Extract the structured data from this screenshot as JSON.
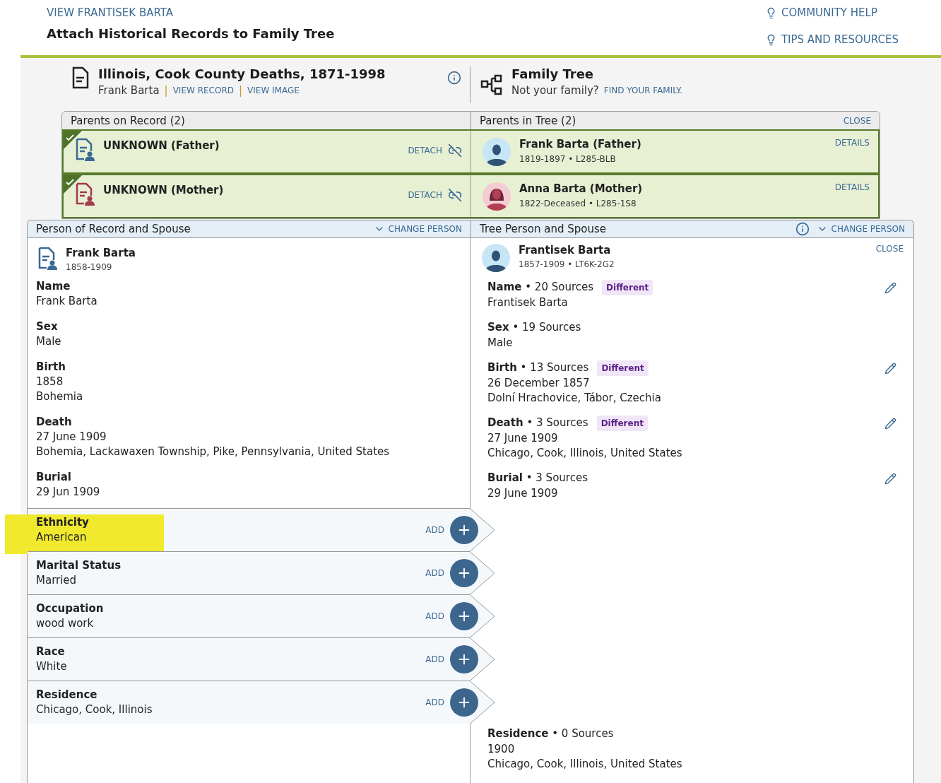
{
  "header": {
    "breadcrumb": "VIEW FRANTISEK BARTA",
    "title": "Attach Historical Records to Family Tree",
    "links": [
      "COMMUNITY HELP",
      "TIPS AND RESOURCES"
    ]
  },
  "record": {
    "title": "Illinois, Cook County Deaths, 1871-1998",
    "person": "Frank Barta",
    "links": [
      {
        "separator": "|",
        "label": "VIEW RECORD"
      },
      {
        "separator": "|",
        "label": "VIEW IMAGE"
      }
    ]
  },
  "tree": {
    "title": "Family Tree",
    "prompt": "Not your family?",
    "link": "FIND YOUR FAMILY."
  },
  "parents": {
    "record_heading": "Parents on Record (2)",
    "tree_heading": "Parents in Tree (2)",
    "close": "CLOSE",
    "rows": [
      {
        "kind": "father",
        "record_name": "UNKNOWN (Father)",
        "attached": true,
        "detach": "DETACH",
        "tree_name": "Frank Barta (Father)",
        "tree_info": "1819-1897 • L285-BLB",
        "details": "DETAILS"
      },
      {
        "kind": "mother",
        "record_name": "UNKNOWN (Mother)",
        "attached": true,
        "detach": "DETACH",
        "tree_name": "Anna Barta (Mother)",
        "tree_info": "1822-Deceased • L285-1S8",
        "details": "DETAILS"
      }
    ]
  },
  "person": {
    "record_heading": "Person of Record and Spouse",
    "record_change": "CHANGE PERSON",
    "tree_heading": "Tree Person and Spouse",
    "tree_change": "CHANGE PERSON",
    "record_person": {
      "name": "Frank Barta",
      "dates": "1858-1909"
    },
    "facts": [
      {
        "label": "Name",
        "lines": [
          "Frank Barta"
        ]
      },
      {
        "label": "Sex",
        "lines": [
          "Male"
        ]
      },
      {
        "label": "Birth",
        "lines": [
          "1858",
          "Bohemia"
        ]
      },
      {
        "label": "Death",
        "lines": [
          "27 June 1909",
          "Bohemia, Lackawaxen Township, Pike, Pennsylvania, United States"
        ]
      },
      {
        "label": "Burial",
        "lines": [
          "29 Jun 1909"
        ]
      }
    ],
    "additions": [
      {
        "label": "Ethnicity",
        "value": "American",
        "action": "ADD",
        "highlighted": true
      },
      {
        "label": "Marital Status",
        "value": "Married",
        "action": "ADD",
        "highlighted": false
      },
      {
        "label": "Occupation",
        "value": "wood work",
        "action": "ADD",
        "highlighted": false
      },
      {
        "label": "Race",
        "value": "White",
        "action": "ADD",
        "highlighted": false
      },
      {
        "label": "Residence",
        "value": "Chicago, Cook, Illinois",
        "action": "ADD",
        "highlighted": false
      }
    ],
    "tree_person": {
      "name": "Frantisek Barta",
      "info": "1857-1909 • LT6K-2G2",
      "close": "CLOSE"
    },
    "tree_facts": [
      {
        "heading": "**Name** • 20 Sources",
        "badge": "Different",
        "editable": true,
        "lines": [
          "Frantisek Barta"
        ]
      },
      {
        "heading": "**Sex** • 19 Sources",
        "editable": false,
        "lines": [
          "Male"
        ]
      },
      {
        "heading": "**Birth** • 13 Sources",
        "badge": "Different",
        "editable": true,
        "lines": [
          "26 December 1857",
          "Dolní Hrachovice, Tábor, Czechia"
        ]
      },
      {
        "heading": "**Death** • 3 Sources",
        "badge": "Different",
        "editable": true,
        "lines": [
          "27 June 1909",
          "Chicago, Cook, Illinois, United States"
        ]
      },
      {
        "heading": "**Burial** • 3 Sources",
        "editable": true,
        "lines": [
          "29 June 1909"
        ]
      }
    ],
    "tree_bottom_fact": {
      "heading": "**Residence** • 0 Sources",
      "lines": [
        "1900",
        "Chicago, Cook, Illinois, United States"
      ]
    }
  }
}
